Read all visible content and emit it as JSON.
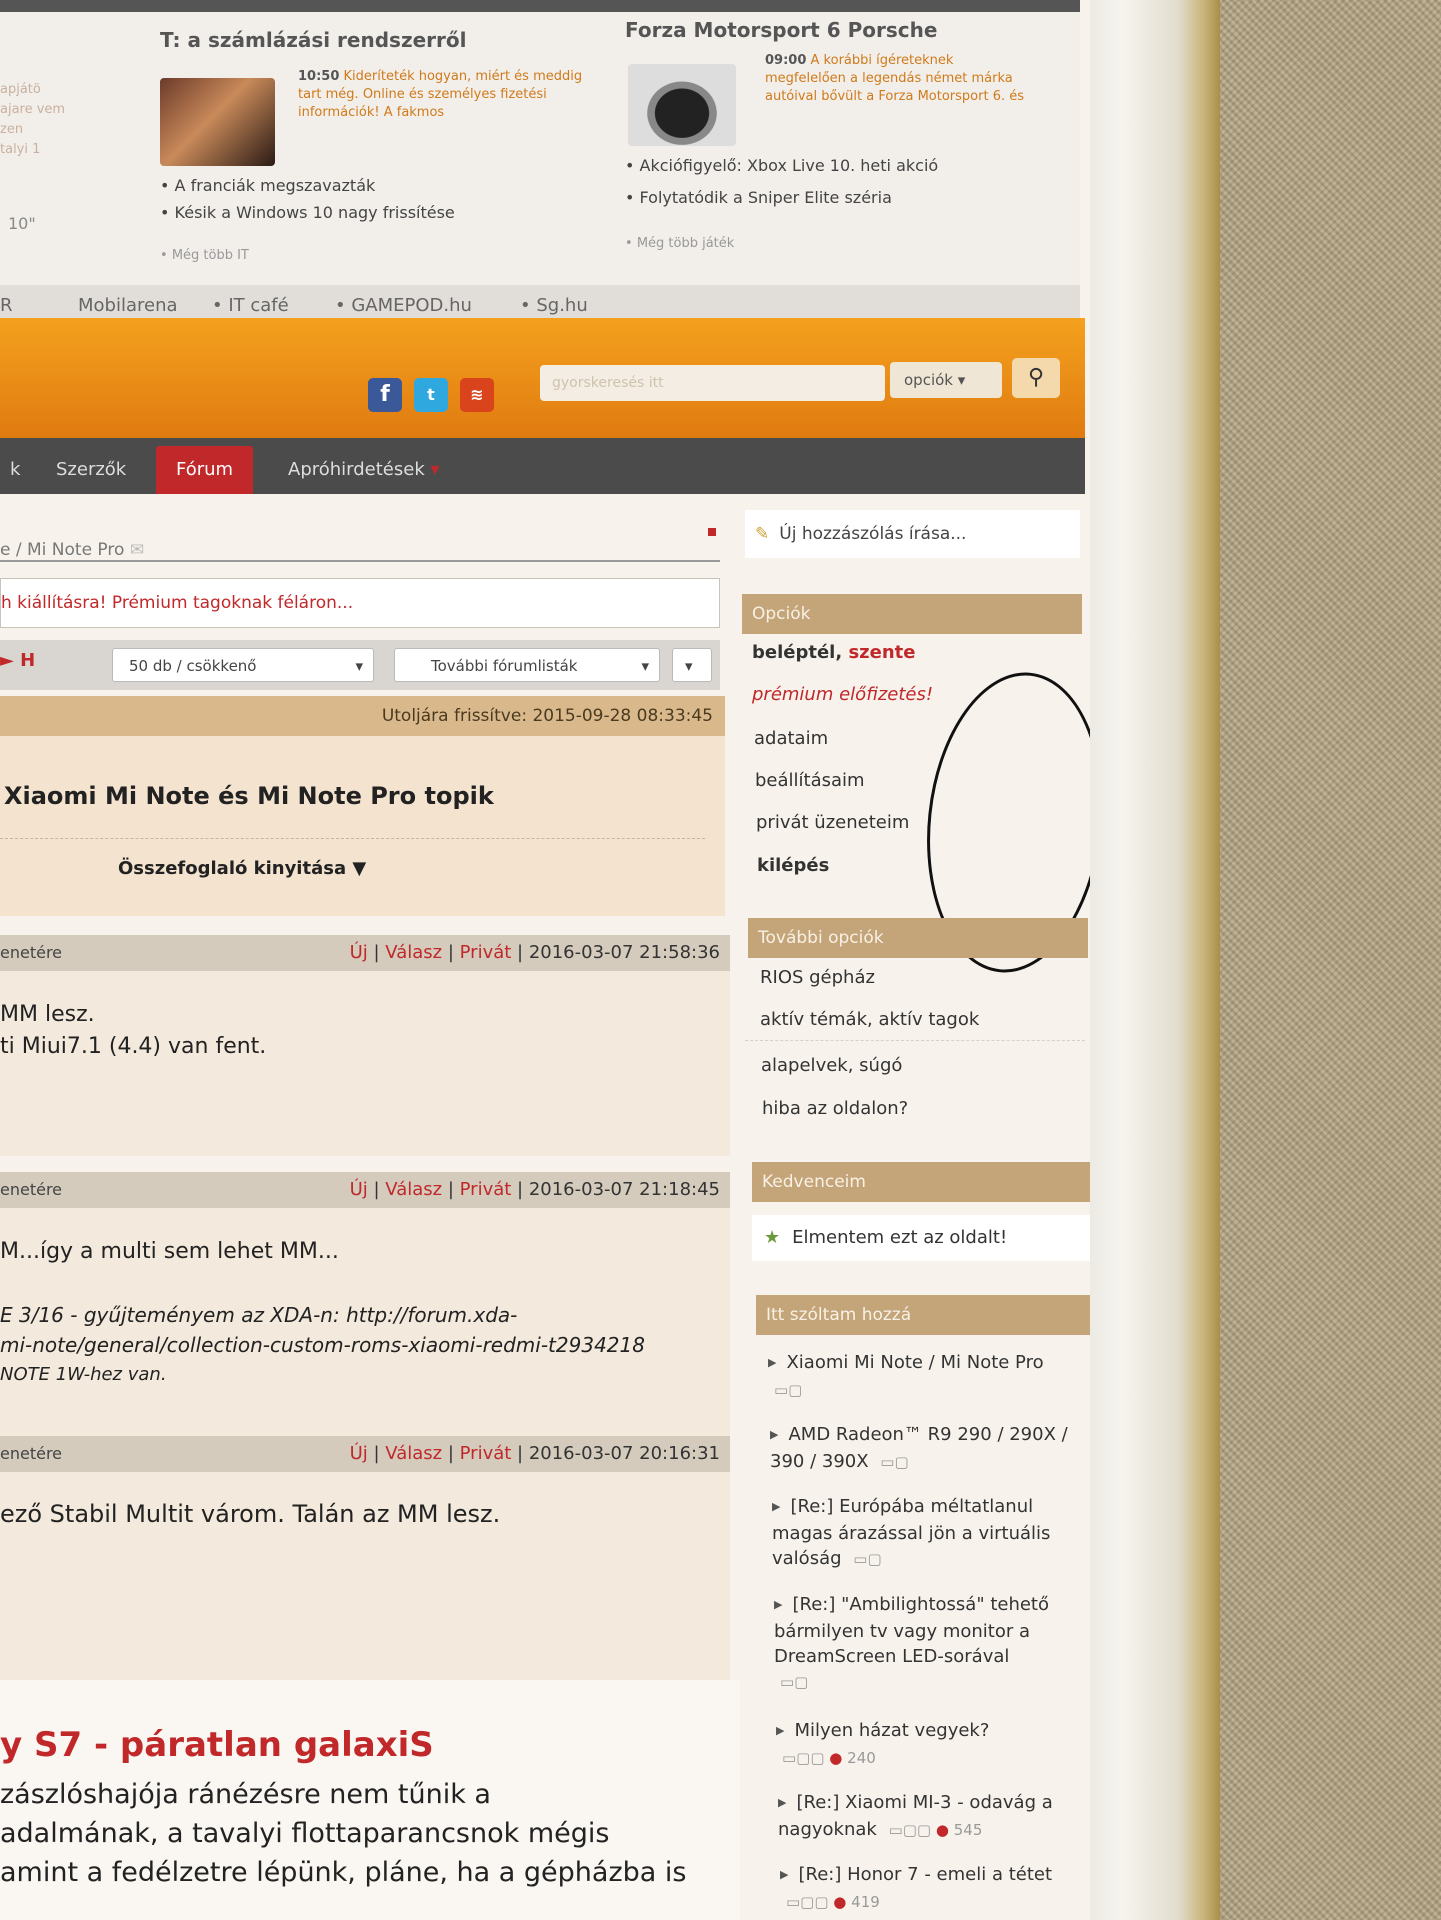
{
  "news": {
    "left_heading": "T: a számlázási rendszerről",
    "left_blurb_time": "10:50",
    "left_blurb": "Kideríteték hogyan, miért és meddig tart még. Online és személyes fizetési információk! A fakmos",
    "left_side_text": [
      "apjátö",
      "ajare vem",
      "zen",
      "talyi 1"
    ],
    "left_bullets": [
      "A franciák megszavazták",
      "Késik a Windows 10 nagy frissítése"
    ],
    "left_more": "Még több IT",
    "left_edge_text": "10\"",
    "right_heading": "Forza Motorsport 6 Porsche",
    "right_blurb_time": "09:00",
    "right_blurb": "A korábbi ígéreteknek megfelelően a legendás német márka autóival bővült a Forza Motorsport 6. és",
    "right_bullets": [
      "Akciófigyelő: Xbox Live 10. heti akció",
      "Folytatódik a Sniper Elite széria"
    ],
    "right_more": "Még több játék"
  },
  "sites": [
    "R",
    "Mobilarena",
    "IT café",
    "GAMEPOD.hu",
    "Sg.hu"
  ],
  "header": {
    "search_placeholder": "gyorskeresés itt",
    "options_label": "opciók",
    "search_icon": "⚲"
  },
  "tabs": [
    "k",
    "Szerzők",
    "Fórum",
    "Apróhirdetések"
  ],
  "breadcrumb": "e / Mi Note Pro",
  "promo": "h kiállításra! Prémium tagoknak féláron...",
  "controls": {
    "pager": "► H",
    "per_page": "50 db / csökkenő",
    "more_lists": "További fórumlisták"
  },
  "updated": "Utoljára frissítve: 2015-09-28 08:33:45",
  "topic_title": "Xiaomi Mi Note és Mi Note Pro topik",
  "summary_toggle": "Összefoglaló kinyitása ▼",
  "post_actions": {
    "new": "Új",
    "reply": "Válasz",
    "private": "Privát"
  },
  "posts": [
    {
      "author_tail": "enetére",
      "time": "2016-03-07 21:58:36",
      "lines": [
        "MM lesz.",
        "ti Miui7.1 (4.4) van fent."
      ]
    },
    {
      "author_tail": "enetére",
      "time": "2016-03-07 21:18:45",
      "lines": [
        "M...így a multi sem lehet MM..."
      ],
      "italic_lines": [
        "E 3/16 - gyűjteményem az XDA-n: http://forum.xda-",
        "mi-note/general/collection-custom-roms-xiaomi-redmi-t2934218",
        "NOTE 1W-hez van."
      ]
    },
    {
      "author_tail": "enetére",
      "time": "2016-03-07 20:16:31",
      "lines": [
        "ező Stabil Multit várom. Talán az MM lesz."
      ]
    }
  ],
  "article": {
    "title": "y S7 - páratlan galaxiS",
    "lines": [
      "zászlóshajója ránézésre nem tűnik a",
      "adalmának, a tavalyi flottaparancsnok mégis",
      "amint a fedélzetre lépünk, pláne, ha a gépházba is"
    ]
  },
  "sidebar": {
    "new_post": "Új hozzászólás írása...",
    "options_head": "Opciók",
    "logged_in": "beléptél,",
    "username": "szente",
    "options": [
      "prémium előfizetés!",
      "adataim",
      "beállításaim",
      "privát üzeneteim",
      "kilépés"
    ],
    "more_head": "További opciók",
    "more": [
      "RIOS gépház",
      "aktív témák, aktív tagok",
      "alapelvek, súgó",
      "hiba az oldalon?"
    ],
    "fav_head": "Kedvenceim",
    "save_page": "Elmentem ezt az oldalt!",
    "spoke_head": "Itt szóltam hozzá",
    "threads": [
      {
        "title": "Xiaomi Mi Note / Mi Note Pro",
        "count": ""
      },
      {
        "title": "AMD Radeon™ R9 290 / 290X / 390 / 390X",
        "count": ""
      },
      {
        "title": "[Re:] Európába méltatlanul magas árazással jön a virtuális valóság",
        "count": ""
      },
      {
        "title": "[Re:] \"Ambilightossá\" tehető bármilyen tv vagy monitor a DreamScreen LED-sorával",
        "count": ""
      },
      {
        "title": "Milyen házat vegyek?",
        "count": "240"
      },
      {
        "title": "[Re:] Xiaomi MI-3 - odavág a nagyoknak",
        "count": "545"
      },
      {
        "title": "[Re:] Honor 7 - emeli a tétet",
        "count": "419"
      }
    ]
  },
  "colors": {
    "accent_red": "#c0282a",
    "orange": "#f09a1a",
    "tan": "#c4a57a"
  }
}
